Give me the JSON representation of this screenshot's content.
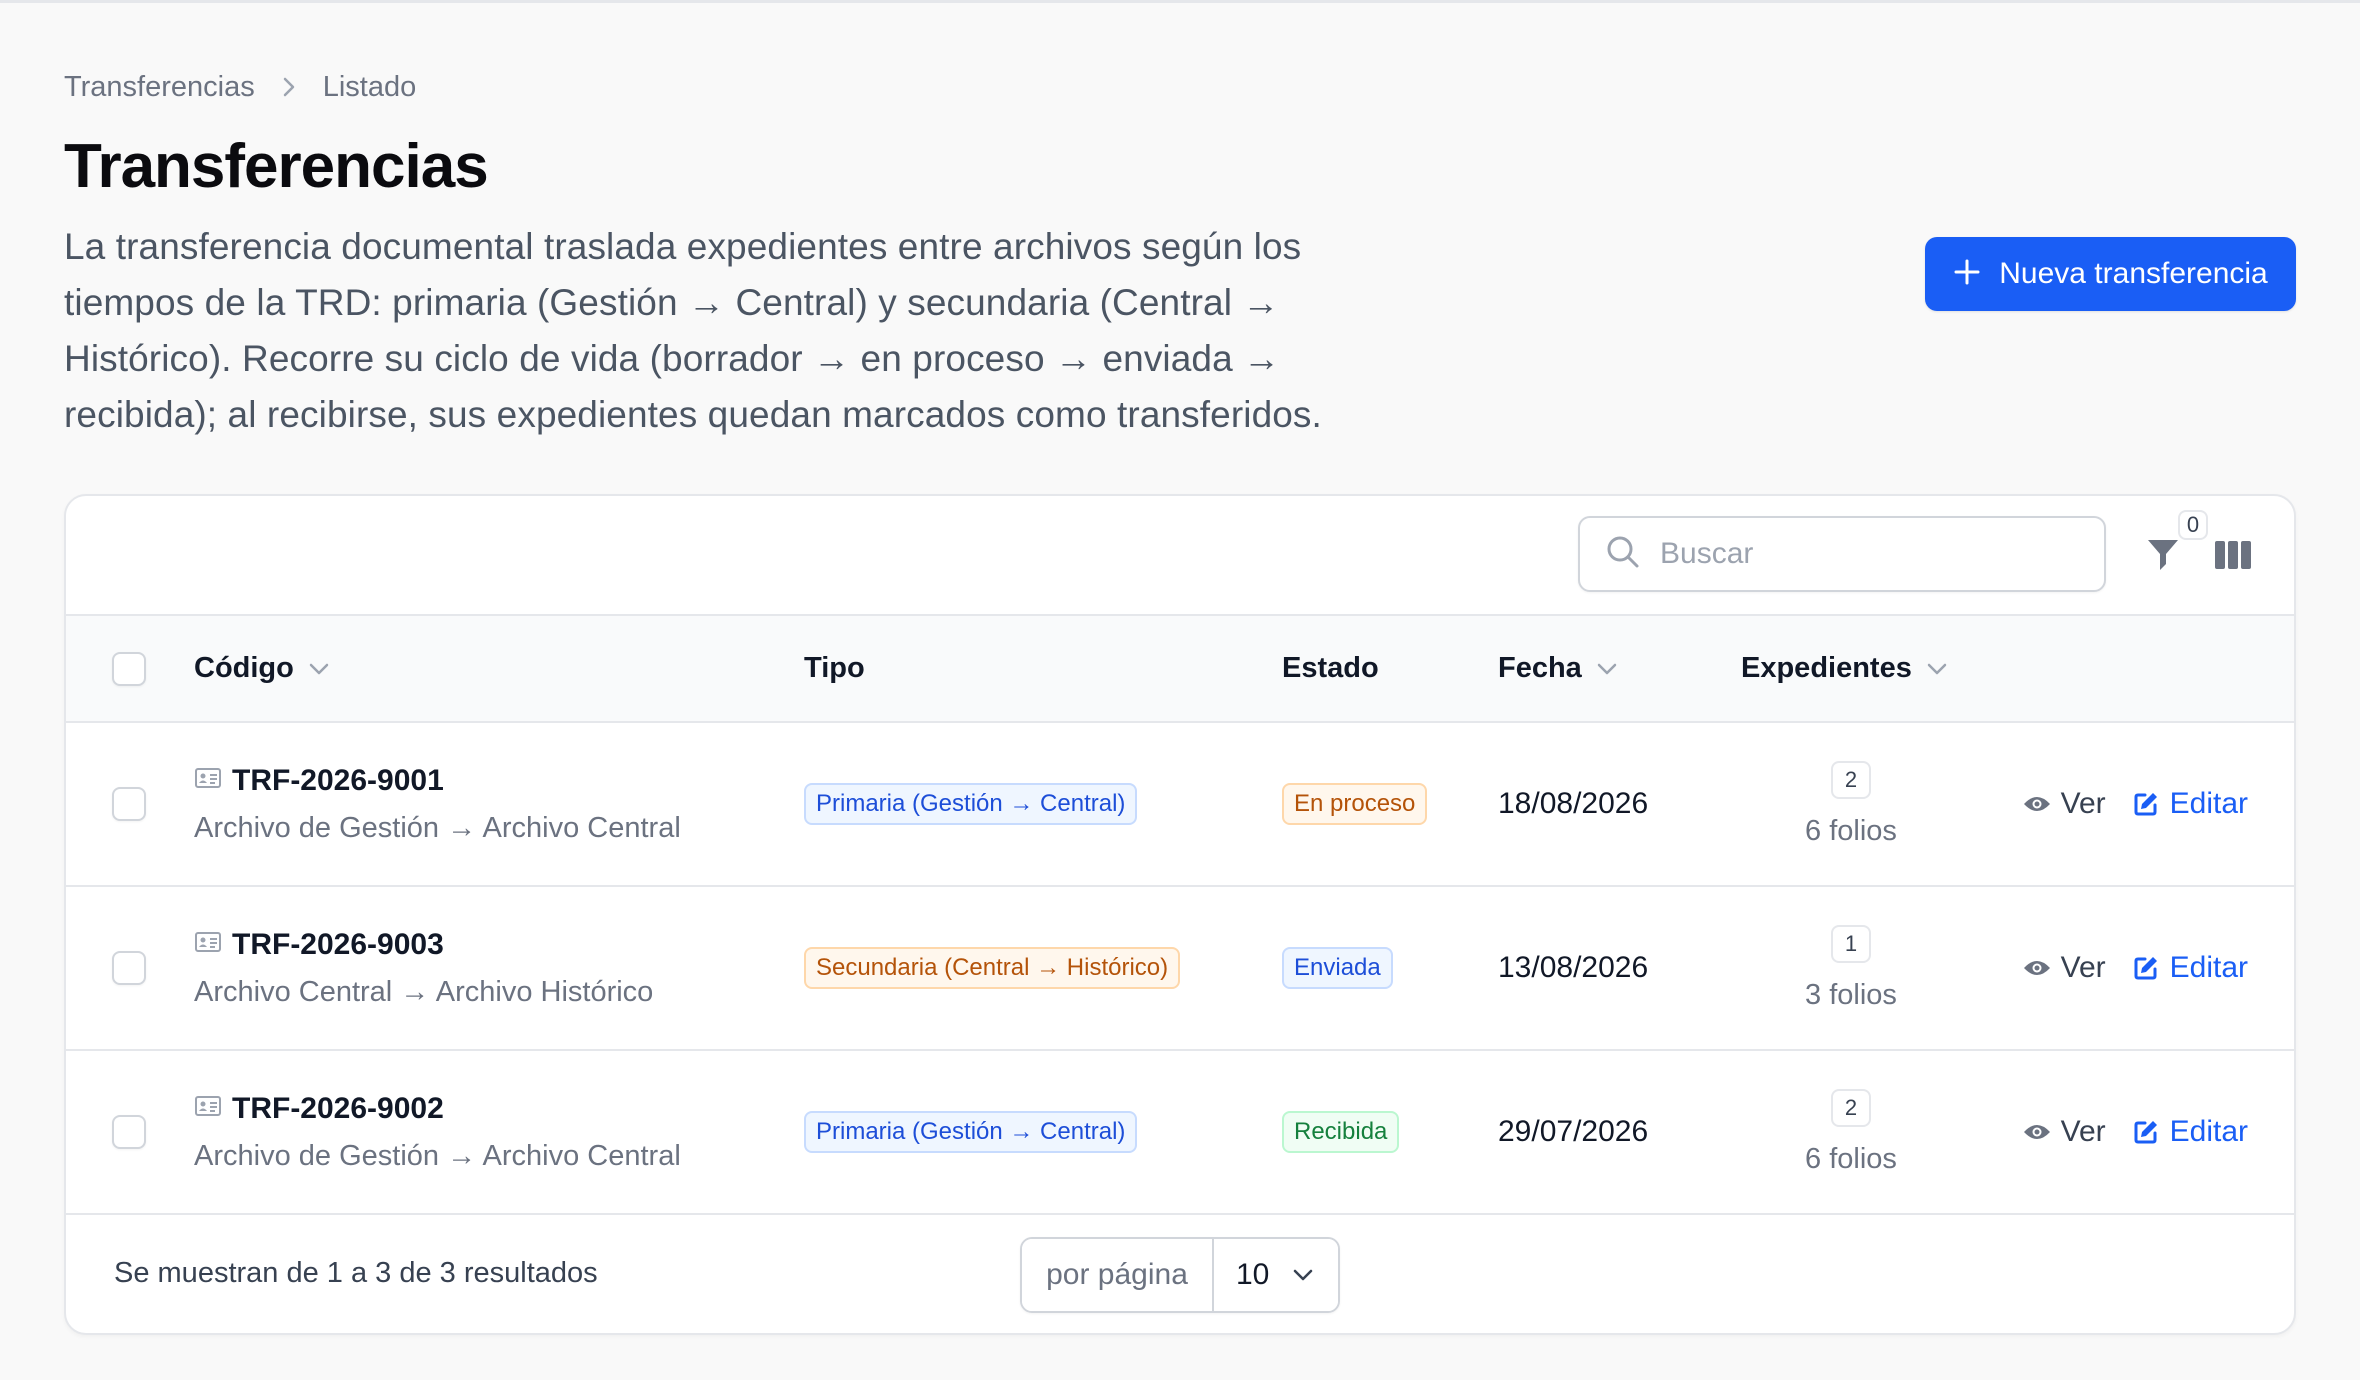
{
  "breadcrumb": {
    "parent": "Transferencias",
    "current": "Listado"
  },
  "header": {
    "title": "Transferencias",
    "description": "La transferencia documental traslada expedientes entre archivos según los tiempos de la TRD: primaria (Gestión → Central) y secundaria (Central → Histórico). Recorre su ciclo de vida (borrador → en proceso → enviada → recibida); al recibirse, sus expedientes quedan marcados como transferidos.",
    "new_button_label": "Nueva transferencia"
  },
  "toolbar": {
    "search_placeholder": "Buscar",
    "filter_count": "0"
  },
  "table": {
    "columns": {
      "codigo": "Código",
      "tipo": "Tipo",
      "estado": "Estado",
      "fecha": "Fecha",
      "expedientes": "Expedientes"
    },
    "rows": [
      {
        "code": "TRF-2026-9001",
        "route": "Archivo de Gestión → Archivo Central",
        "tipo": "Primaria (Gestión → Central)",
        "estado": "En proceso",
        "fecha": "18/08/2026",
        "exp_count": "2",
        "folios": "6 folios",
        "view_label": "Ver",
        "edit_label": "Editar"
      },
      {
        "code": "TRF-2026-9003",
        "route": "Archivo Central → Archivo Histórico",
        "tipo": "Secundaria (Central → Histórico)",
        "estado": "Enviada",
        "fecha": "13/08/2026",
        "exp_count": "1",
        "folios": "3 folios",
        "view_label": "Ver",
        "edit_label": "Editar"
      },
      {
        "code": "TRF-2026-9002",
        "route": "Archivo de Gestión → Archivo Central",
        "tipo": "Primaria (Gestión → Central)",
        "estado": "Recibida",
        "fecha": "29/07/2026",
        "exp_count": "2",
        "folios": "6 folios",
        "view_label": "Ver",
        "edit_label": "Editar"
      }
    ]
  },
  "footer": {
    "summary": "Se muestran de 1 a 3 de 3 resultados",
    "per_page_label": "por página",
    "per_page_value": "10"
  },
  "colors": {
    "primary": "#1a5ef5",
    "badge_blue": "#1d4ed8",
    "badge_orange": "#b45309",
    "badge_green": "#15803d"
  }
}
